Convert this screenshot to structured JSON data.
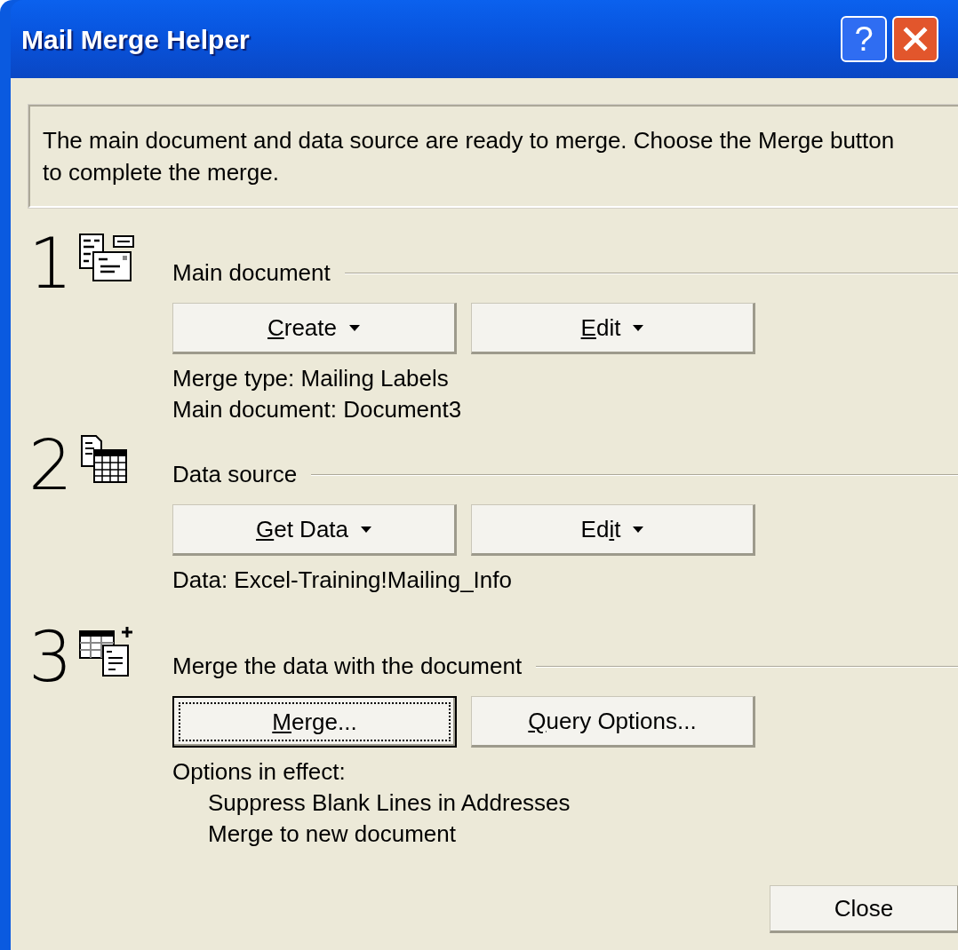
{
  "window": {
    "title": "Mail Merge Helper",
    "controls": [
      {
        "kind": "help",
        "label": "?"
      },
      {
        "kind": "close"
      }
    ]
  },
  "message": "The main document and data source are ready to merge. Choose the Merge button to complete the merge.",
  "steps": [
    {
      "number": "1",
      "heading": "Main document",
      "buttons": [
        {
          "key": "C",
          "after": "reate",
          "dropdown": true,
          "focused": false
        },
        {
          "key": "E",
          "after": "dit",
          "dropdown": true,
          "focused": false
        }
      ],
      "info": [
        {
          "kind": "line",
          "text": "Merge type: Mailing Labels"
        },
        {
          "kind": "line",
          "text": "Main document: Document3"
        }
      ]
    },
    {
      "number": "2",
      "heading": "Data source",
      "buttons": [
        {
          "key": "G",
          "after": "et Data",
          "dropdown": true,
          "focused": false
        },
        {
          "before": "Ed",
          "key": "i",
          "after": "t",
          "dropdown": true,
          "focused": false
        }
      ],
      "info": [
        {
          "kind": "line",
          "text": "Data: Excel-Training!Mailing_Info"
        }
      ]
    },
    {
      "number": "3",
      "heading": "Merge the data with the document",
      "buttons": [
        {
          "key": "M",
          "after": "erge...",
          "dropdown": false,
          "focused": true
        },
        {
          "key": "Q",
          "after": "uery Options...",
          "dropdown": false,
          "focused": false
        }
      ],
      "info": [
        {
          "kind": "line",
          "text": "Options in effect:"
        },
        {
          "kind": "option",
          "text": "Suppress Blank Lines in Addresses"
        },
        {
          "kind": "option",
          "text": "Merge to new document"
        }
      ]
    }
  ],
  "close_button": "Close"
}
